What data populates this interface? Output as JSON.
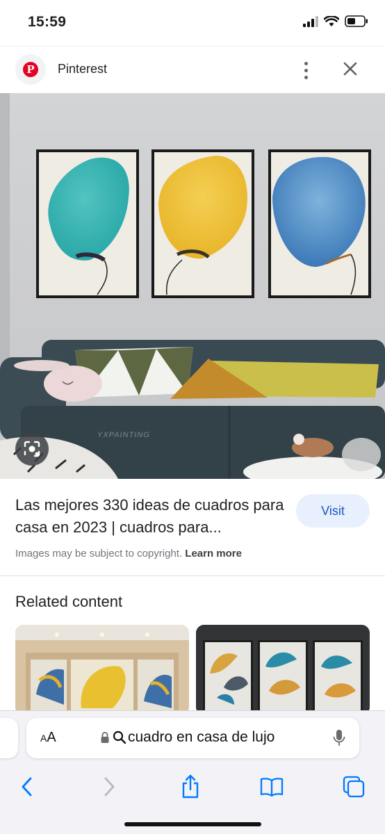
{
  "status_bar": {
    "time": "15:59"
  },
  "source": {
    "name": "Pinterest",
    "logo_letter": "P",
    "logo_color": "#e60023"
  },
  "result": {
    "title": "Las mejores 330 ideas de cuadros para casa en 2023 | cuadros para...",
    "visit_label": "Visit",
    "copyright_text": "Images may be subject to copyright.",
    "learn_more_label": "Learn more",
    "watermark_text": "YXPAINTING"
  },
  "related": {
    "title": "Related content"
  },
  "address_bar": {
    "aa_label_small": "A",
    "aa_label_large": "A",
    "url_text": "cuadro en casa de lujo"
  },
  "icons": {
    "close": "close-icon",
    "more": "more-vertical-icon",
    "lens": "lens-icon",
    "back": "chevron-left-icon",
    "forward": "chevron-right-icon",
    "share": "share-icon",
    "bookmarks": "book-icon",
    "tabs": "tabs-icon",
    "mic": "microphone-icon",
    "lock": "lock-icon",
    "search": "search-icon"
  },
  "colors": {
    "accent": "#1a56c4",
    "visit_bg": "#e8f0fe",
    "ios_blue": "#007aff"
  }
}
